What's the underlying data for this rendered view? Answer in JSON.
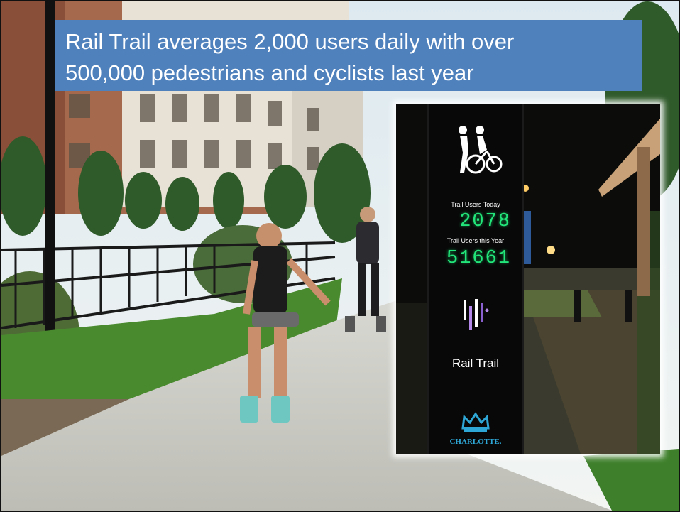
{
  "caption": {
    "line1": "Rail Trail averages 2,000 users daily with over",
    "line2": "500,000 pedestrians and cyclists last year"
  },
  "sign": {
    "today_label": "Trail Users Today",
    "today_count": "2078",
    "year_label": "Trail Users this Year",
    "year_count": "51661",
    "brand": "Rail Trail",
    "city": "CHARLOTTE."
  },
  "colors": {
    "caption_bg": "#4f81bd",
    "counter_digits": "#22e67a",
    "brand_purple": "#b388e8",
    "city_blue": "#2fa7d6"
  }
}
